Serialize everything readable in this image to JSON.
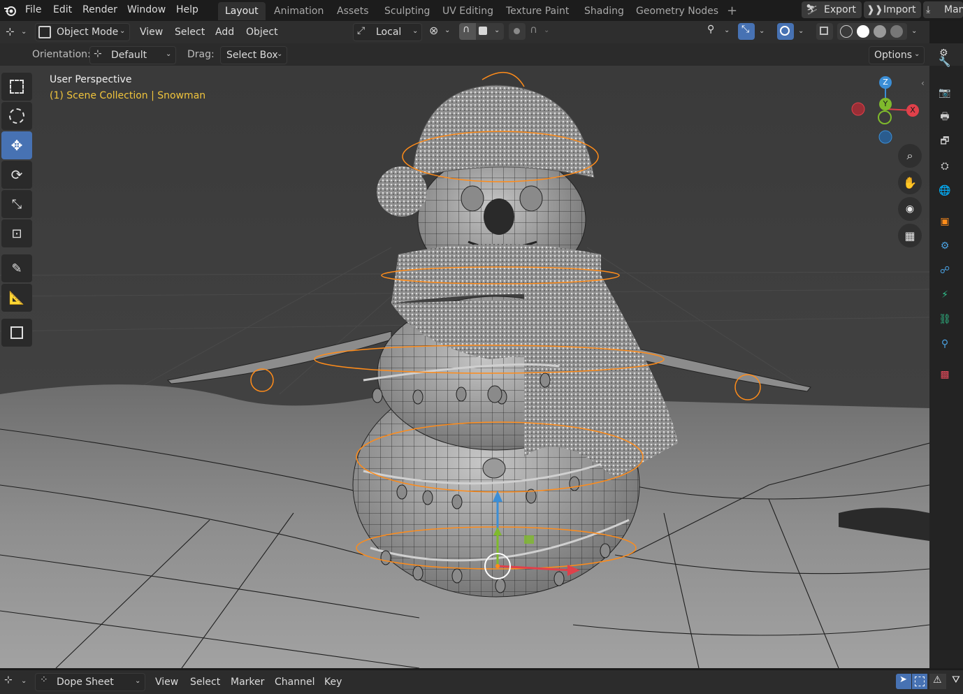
{
  "menu": [
    "File",
    "Edit",
    "Render",
    "Window",
    "Help"
  ],
  "workspaces": [
    "Layout",
    "Animation",
    "Assets",
    "Sculpting",
    "UV Editing",
    "Texture Paint",
    "Shading",
    "Geometry Nodes"
  ],
  "active_workspace": "Layout",
  "add_workspace": "+",
  "top_right": {
    "export": "Export",
    "import": "Import",
    "manage": "Man"
  },
  "header": {
    "mode": "Object Mode",
    "view": "View",
    "select": "Select",
    "add": "Add",
    "object": "Object",
    "transform_space": "Local"
  },
  "tool_settings": {
    "orientation_label": "Orientation:",
    "orientation_value": "Default",
    "drag_label": "Drag:",
    "drag_value": "Select Box",
    "options": "Options"
  },
  "viewport": {
    "perspective": "User Perspective",
    "collection": "(1) Scene Collection | Snowman"
  },
  "gizmo": {
    "z": "Z",
    "y": "Y",
    "x": "X"
  },
  "bottom_bar": {
    "editor": "Dope Sheet",
    "menus": [
      "View",
      "Select",
      "Marker",
      "Channel",
      "Key"
    ]
  },
  "colors": {
    "accent": "#4772b3",
    "selection": "#ff8c1a",
    "collection_text": "#f0c43c",
    "axis_x": "#e0404a",
    "axis_y": "#7fba2c",
    "axis_z": "#3b8ed6"
  },
  "icons": {
    "left_tools": [
      "select-box-icon",
      "cursor-icon",
      "move-icon",
      "rotate-icon",
      "scale-icon",
      "transform-icon",
      "annotate-icon",
      "measure-icon",
      "add-cube-icon"
    ],
    "nav": [
      "zoom-icon",
      "hand-pan-icon",
      "camera-icon",
      "ortho-grid-icon"
    ],
    "properties": [
      "tool-icon",
      "render-icon",
      "output-icon",
      "view-layer-icon",
      "scene-icon",
      "world-icon",
      "object-icon",
      "modifier-icon",
      "particles-icon",
      "physics-icon",
      "constraints-icon",
      "data-icon",
      "texture-icon"
    ]
  }
}
